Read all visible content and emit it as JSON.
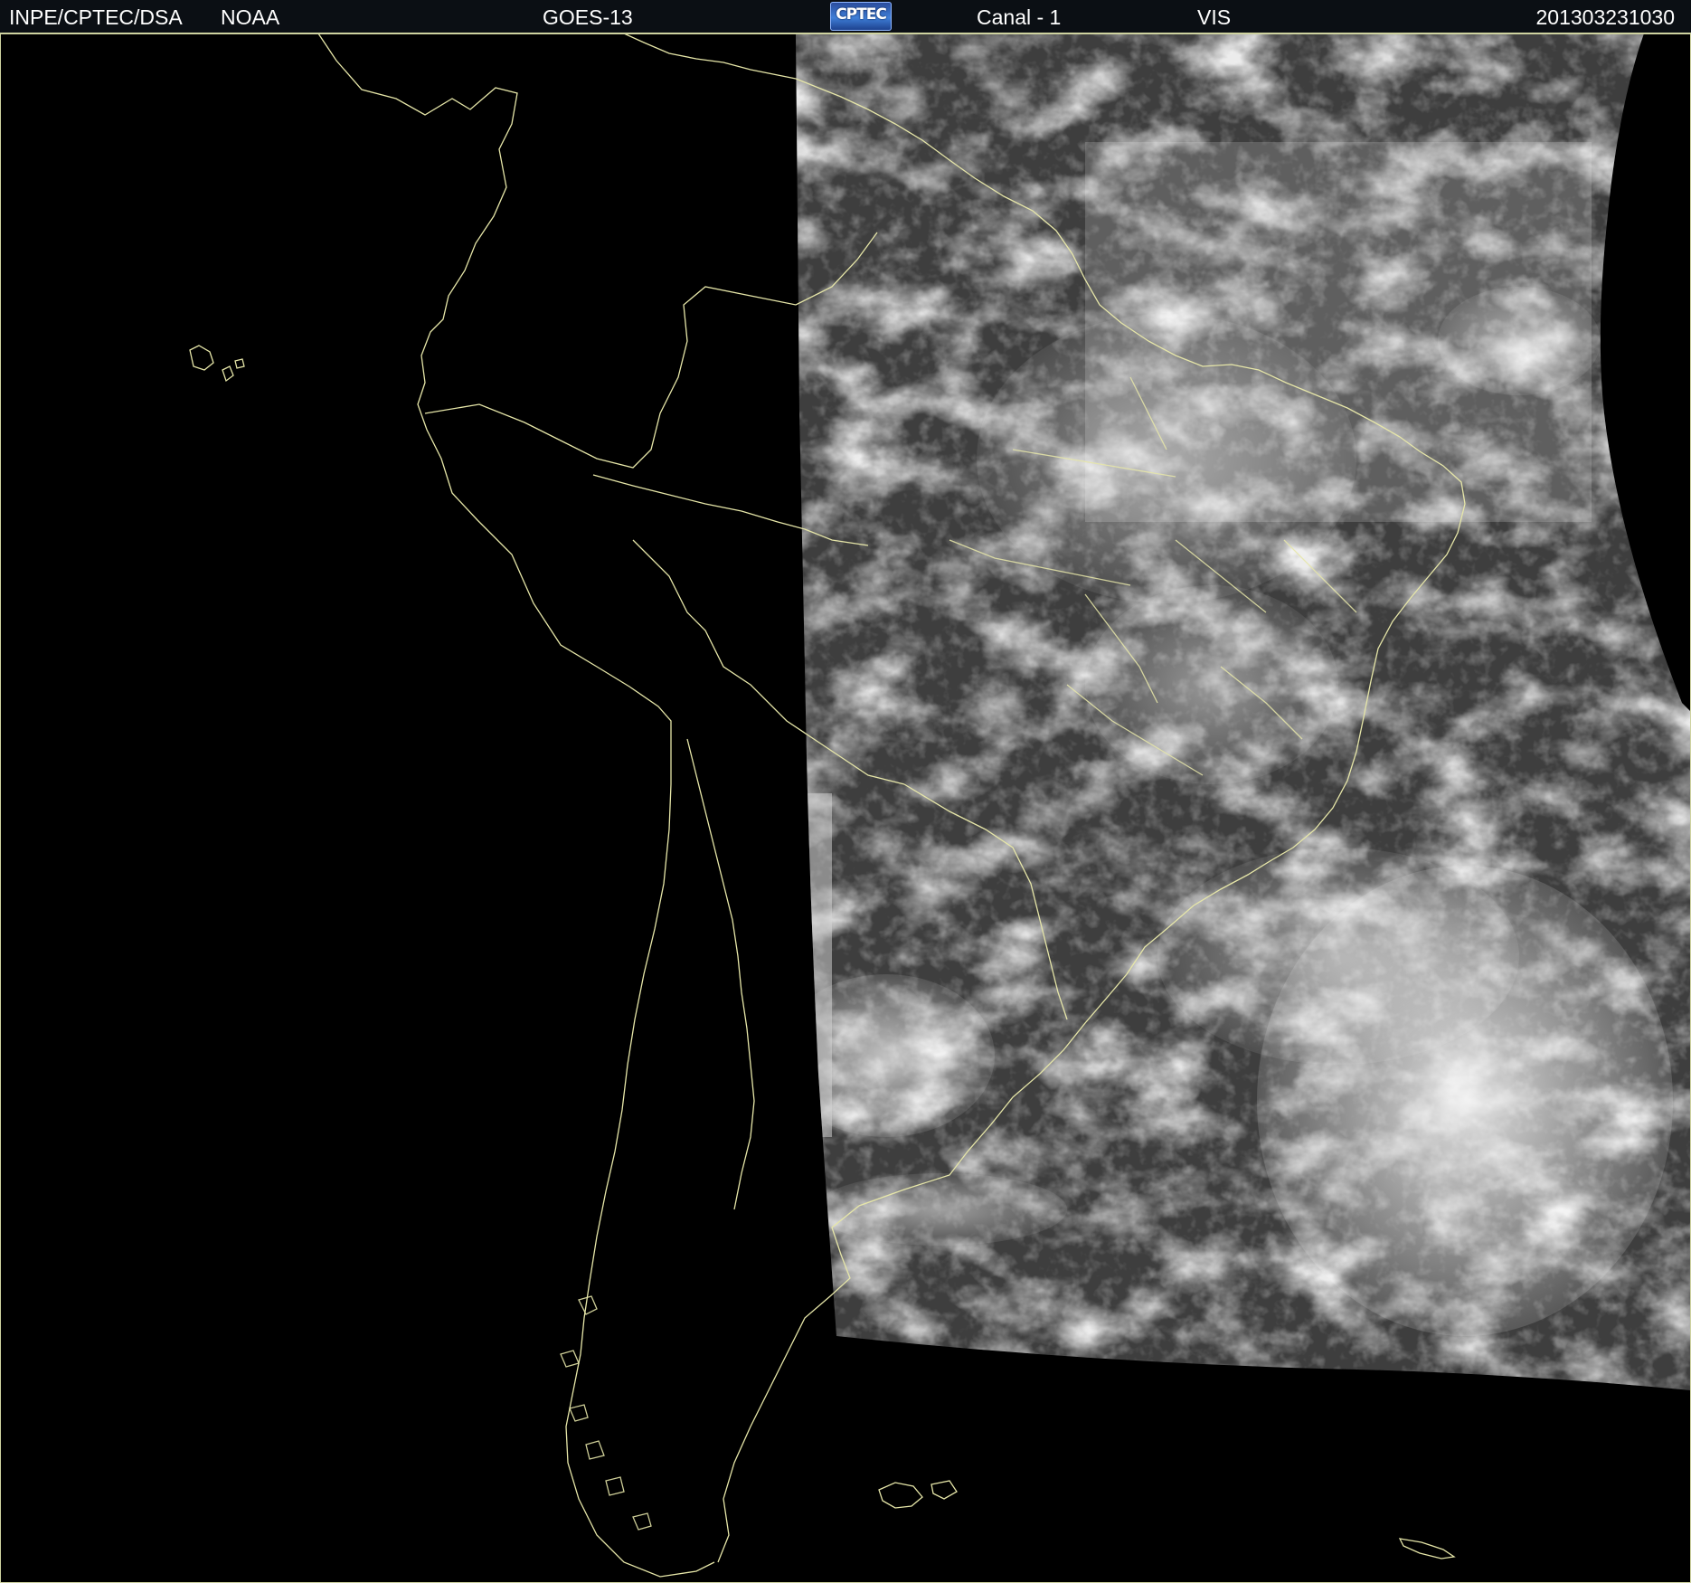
{
  "header": {
    "agency": "INPE/CPTEC/DSA",
    "source": "NOAA",
    "satellite": "GOES-13",
    "logo_text": "CPTEC",
    "channel": "Canal - 1",
    "band": "VIS",
    "timestamp": "201303231030"
  },
  "image": {
    "kind": "satellite visible imagery of South America",
    "background_color": "#000000",
    "coastline_color": "#e6e6a8",
    "cloud_color": "#f2f2f2",
    "surface_color": "#4a4a4a"
  }
}
